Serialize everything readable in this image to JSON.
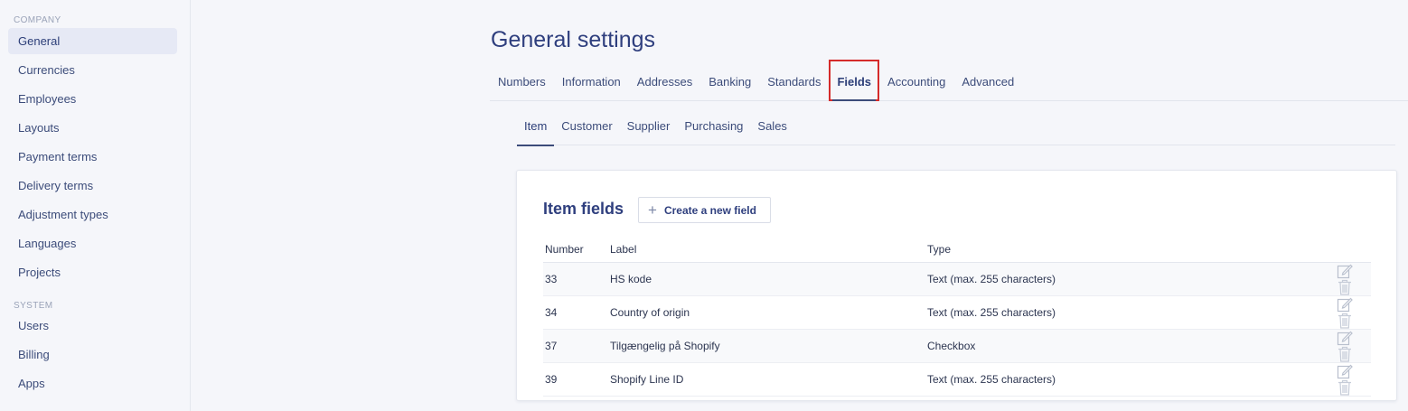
{
  "sidebar": {
    "company_section": "COMPANY",
    "company_items": [
      "General",
      "Currencies",
      "Employees",
      "Layouts",
      "Payment terms",
      "Delivery terms",
      "Adjustment types",
      "Languages",
      "Projects"
    ],
    "system_section": "SYSTEM",
    "system_items": [
      "Users",
      "Billing",
      "Apps"
    ],
    "active": "General"
  },
  "page": {
    "title": "General settings"
  },
  "tabs": [
    "Numbers",
    "Information",
    "Addresses",
    "Banking",
    "Standards",
    "Fields",
    "Accounting",
    "Advanced"
  ],
  "active_tab": "Fields",
  "subtabs": [
    "Item",
    "Customer",
    "Supplier",
    "Purchasing",
    "Sales"
  ],
  "active_subtab": "Item",
  "card": {
    "title": "Item fields",
    "create_label": "Create a new field",
    "columns": {
      "number": "Number",
      "label": "Label",
      "type": "Type"
    },
    "rows": [
      {
        "number": "33",
        "label": "HS kode",
        "type": "Text (max. 255 characters)"
      },
      {
        "number": "34",
        "label": "Country of origin",
        "type": "Text (max. 255 characters)"
      },
      {
        "number": "37",
        "label": "Tilgængelig på Shopify",
        "type": "Checkbox"
      },
      {
        "number": "39",
        "label": "Shopify Line ID",
        "type": "Text (max. 255 characters)"
      }
    ]
  },
  "icons": {
    "edit": "edit-icon",
    "delete": "trash-icon",
    "add": "plus-icon"
  },
  "colors": {
    "accent": "#2f3f7e",
    "highlight": "#d52b2b",
    "active_bg": "#e6e9f5"
  }
}
